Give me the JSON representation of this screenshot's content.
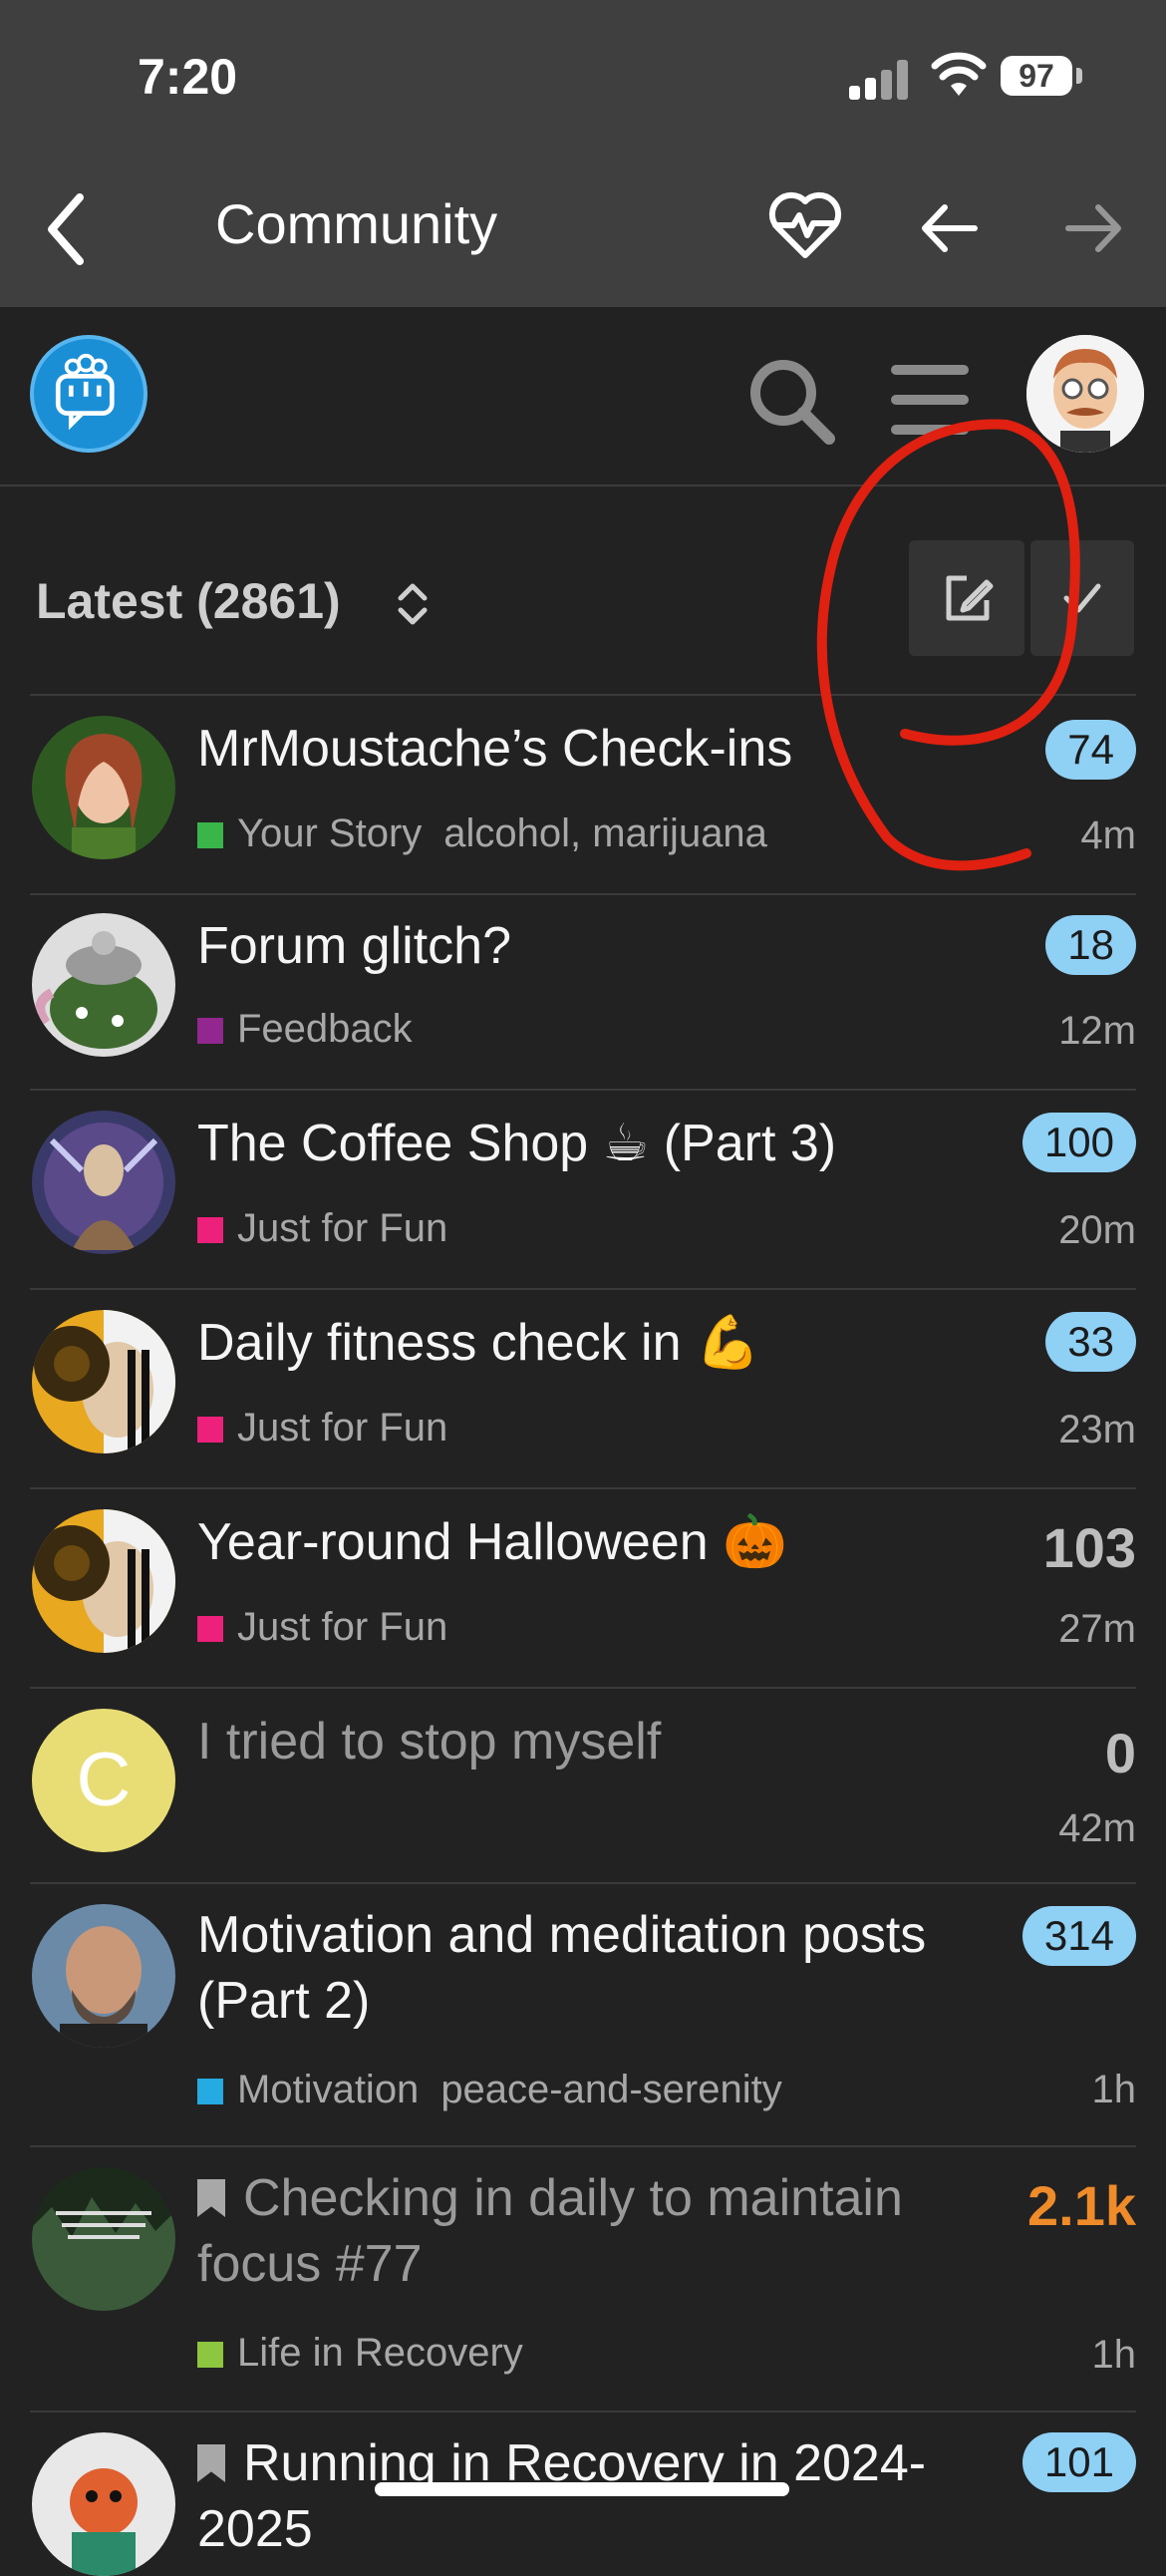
{
  "status": {
    "time": "7:20",
    "battery": "97"
  },
  "nav": {
    "title": "Community",
    "back_icon": "chevron-left-icon",
    "heart_icon": "heart-pulse-icon",
    "arrow_back": "arrow-left-icon",
    "arrow_fwd": "arrow-right-icon"
  },
  "filter": {
    "label": "Latest (2861)"
  },
  "topics": [
    {
      "title": "MrMoustache’s Check-ins",
      "category": "Your Story",
      "category_color": "#3ab54a",
      "tags": "alcohol, marijuana",
      "count": "74",
      "count_style": "badge",
      "age": "4m"
    },
    {
      "title": "Forum glitch?",
      "category": "Feedback",
      "category_color": "#92278f",
      "tags": "",
      "count": "18",
      "count_style": "badge",
      "age": "12m"
    },
    {
      "title": "The Coffee Shop ☕ (Part 3)",
      "category": "Just for Fun",
      "category_color": "#ed207b",
      "tags": "",
      "count": "100",
      "count_style": "badge",
      "age": "20m"
    },
    {
      "title": "Daily fitness check in 💪",
      "category": "Just for Fun",
      "category_color": "#ed207b",
      "tags": "",
      "count": "33",
      "count_style": "badge",
      "age": "23m"
    },
    {
      "title": "Year-round Halloween 🎃",
      "category": "Just for Fun",
      "category_color": "#ed207b",
      "tags": "",
      "count": "103",
      "count_style": "plain",
      "age": "27m"
    },
    {
      "title": "I tried to stop myself",
      "category": "",
      "category_color": "",
      "tags": "",
      "count": "0",
      "count_style": "plain",
      "age": "42m",
      "avatar_letter": "C"
    },
    {
      "title": "Motivation and meditation posts (Part 2)",
      "category": "Motivation",
      "category_color": "#25aae1",
      "tags": "peace-and-serenity",
      "count": "314",
      "count_style": "badge",
      "age": "1h"
    },
    {
      "title": "Checking in daily to maintain focus #77",
      "category": "Life in Recovery",
      "category_color": "#8dc63f",
      "tags": "",
      "count": "2.1k",
      "count_style": "hot",
      "age": "1h",
      "bookmarked": true
    },
    {
      "title": "Running in Recovery in 2024-2025",
      "category": "",
      "category_color": "",
      "tags": "",
      "count": "101",
      "count_style": "badge",
      "age": "",
      "bookmarked": true
    }
  ]
}
